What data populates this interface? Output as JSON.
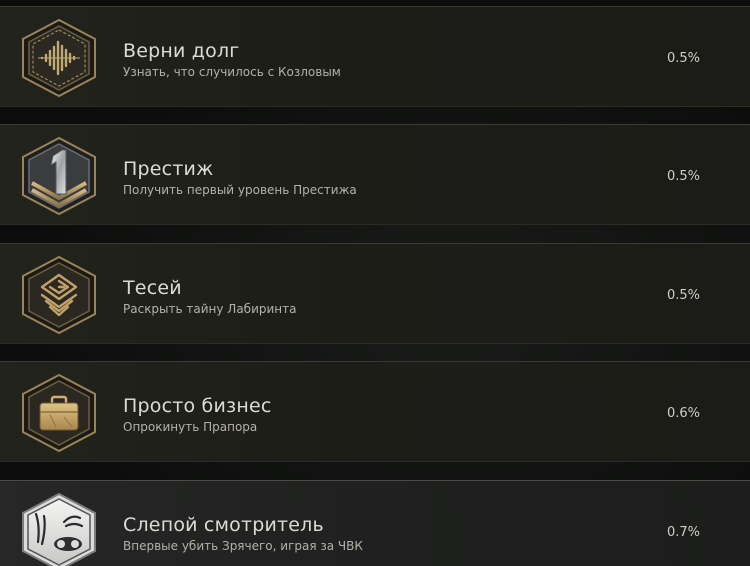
{
  "achievements": [
    {
      "title": "Верни долг",
      "description": "Узнать, что случилось с Козловым",
      "percent": "0.5%",
      "icon": "soundwave-icon",
      "accent": "#b19a6b"
    },
    {
      "title": "Престиж",
      "description": "Получить первый уровень Престижа",
      "percent": "0.5%",
      "icon": "prestige-one-icon",
      "accent": "#c9cbcd"
    },
    {
      "title": "Тесей",
      "description": "Раскрыть тайну Лабиринта",
      "percent": "0.5%",
      "icon": "labyrinth-icon",
      "accent": "#b79a68"
    },
    {
      "title": "Просто бизнес",
      "description": "Опрокинуть Прапора",
      "percent": "0.6%",
      "icon": "briefcase-icon",
      "accent": "#c7a768"
    },
    {
      "title": "Слепой смотритель",
      "description": "Впервые убить Зрячего, играя за ЧВК",
      "percent": "0.7%",
      "icon": "seer-icon",
      "accent": "#d8d8d6"
    }
  ]
}
